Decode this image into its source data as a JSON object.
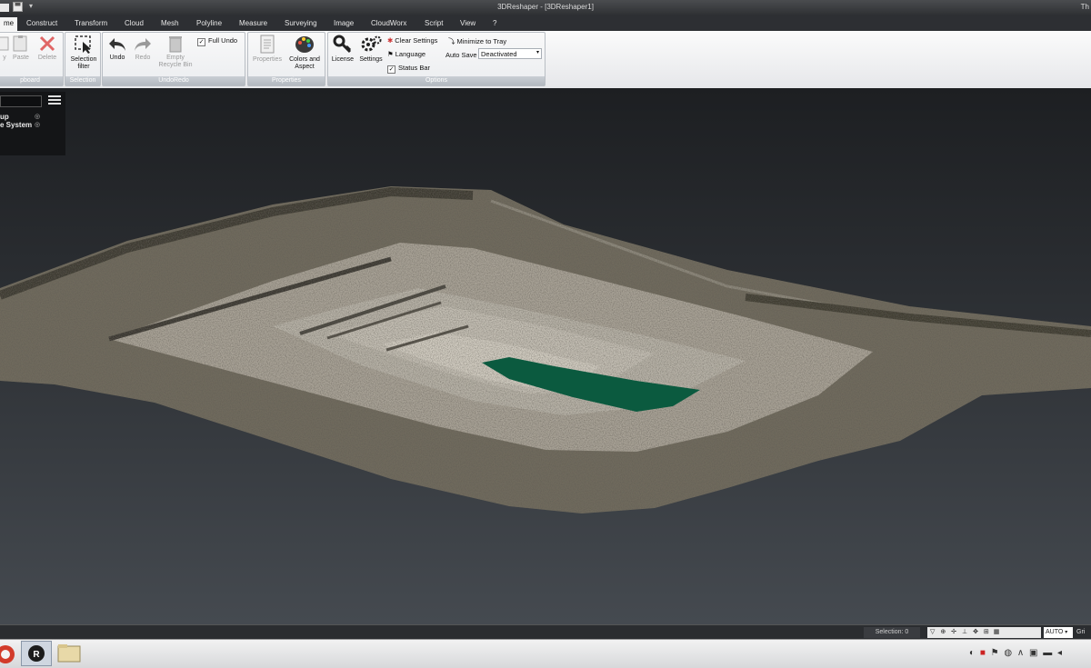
{
  "window": {
    "title": "3DReshaper - [3DReshaper1]",
    "right_label": "Th"
  },
  "tabs": [
    {
      "label": "me",
      "active": true
    },
    {
      "label": "Construct"
    },
    {
      "label": "Transform"
    },
    {
      "label": "Cloud"
    },
    {
      "label": "Mesh"
    },
    {
      "label": "Polyline"
    },
    {
      "label": "Measure"
    },
    {
      "label": "Surveying"
    },
    {
      "label": "Image"
    },
    {
      "label": "CloudWorx"
    },
    {
      "label": "Script"
    },
    {
      "label": "View"
    },
    {
      "label": "?"
    }
  ],
  "ribbon": {
    "clipboard": {
      "label": "pboard",
      "copy": "y",
      "paste": "Paste",
      "delete": "Delete"
    },
    "selection": {
      "label": "Selection",
      "filter": "Selection filter"
    },
    "undoredo": {
      "label": "UndoRedo",
      "undo": "Undo",
      "redo": "Redo",
      "empty": "Empty Recycle Bin",
      "full_undo": "Full Undo",
      "full_undo_checked": true
    },
    "properties": {
      "label": "Properties",
      "properties": "Properties",
      "colors": "Colors and Aspect"
    },
    "options": {
      "label": "Options",
      "license": "License",
      "settings": "Settings",
      "clear_settings": "Clear Settings",
      "language": "Language",
      "status_bar": "Status Bar",
      "status_bar_checked": true,
      "minimize": "Minimize to Tray",
      "auto_save_label": "Auto Save",
      "auto_save_value": "Deactivated"
    }
  },
  "tree": {
    "items": [
      "up",
      "e System"
    ]
  },
  "statusbar": {
    "selection": "Selection: 0",
    "mode": "AUTO",
    "grid": "Gri"
  },
  "colors": {
    "water": "#0b5a3f",
    "accent": "#2f6fd6"
  }
}
